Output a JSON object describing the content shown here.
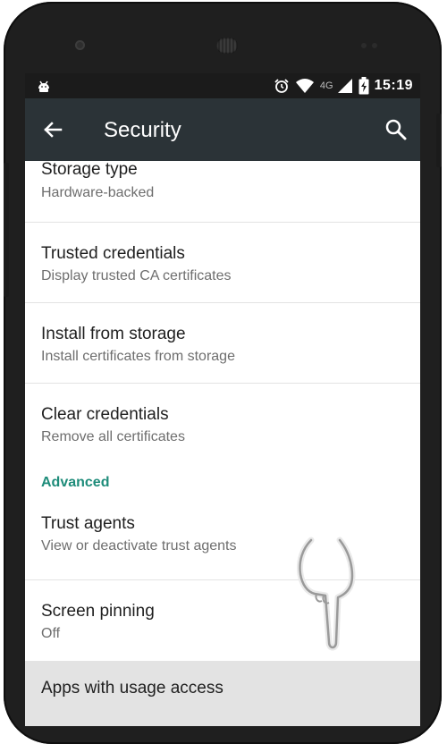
{
  "status_bar": {
    "notification_icon": "android-icon",
    "icons": [
      "alarm-icon",
      "wifi-icon",
      "signal-icon",
      "battery-charging-icon"
    ],
    "network_label": "4G",
    "time": "15:19"
  },
  "toolbar": {
    "back_icon": "back-arrow-icon",
    "title": "Security",
    "search_icon": "search-icon"
  },
  "list": {
    "items": [
      {
        "title": "Storage type",
        "subtitle": "Hardware-backed"
      },
      {
        "title": "Trusted credentials",
        "subtitle": "Display trusted CA certificates"
      },
      {
        "title": "Install from storage",
        "subtitle": "Install certificates from storage"
      },
      {
        "title": "Clear credentials",
        "subtitle": "Remove all certificates"
      }
    ],
    "section_header": "Advanced",
    "advanced_items": [
      {
        "title": "Trust agents",
        "subtitle": "View or deactivate trust agents"
      },
      {
        "title": "Screen pinning",
        "subtitle": "Off"
      },
      {
        "title": "Apps with usage access",
        "subtitle": ""
      }
    ]
  },
  "colors": {
    "toolbar": "#2b3337",
    "status_bar": "#1b1b1b",
    "accent": "#1e8c7a",
    "highlight": "#e3e3e3"
  },
  "overlay": {
    "icon": "tap-hand-icon"
  }
}
